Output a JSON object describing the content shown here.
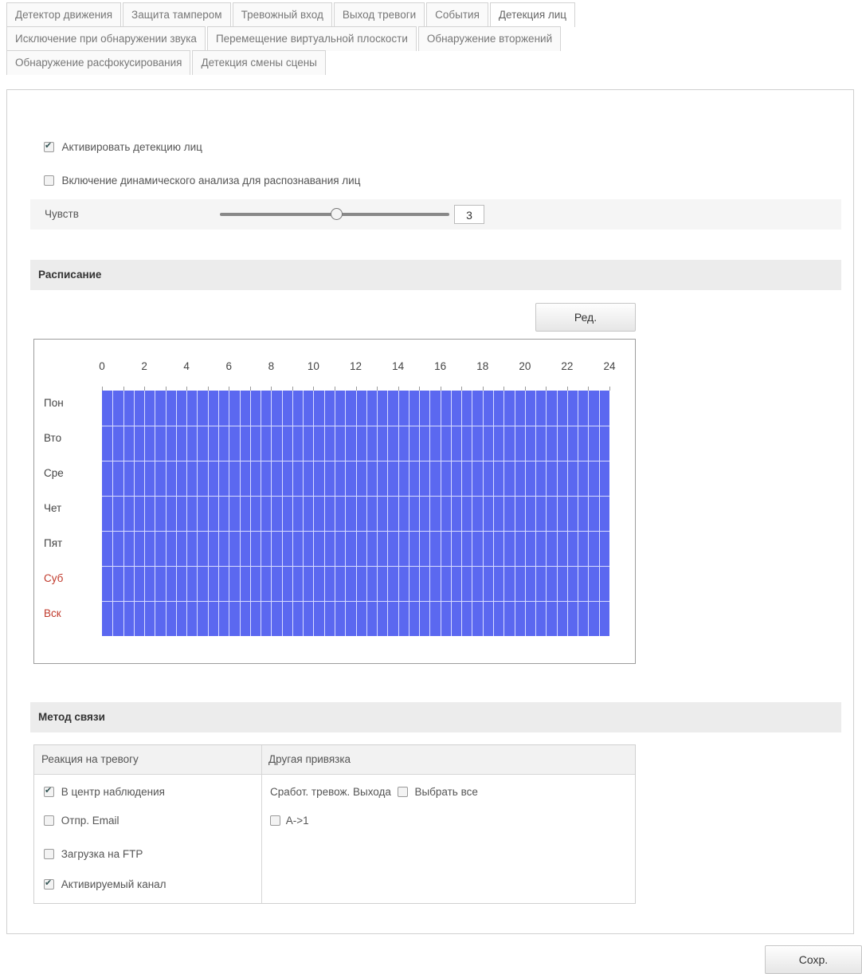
{
  "tabs": {
    "row1": [
      "Детектор движения",
      "Защита тампером",
      "Тревожный вход",
      "Выход тревоги",
      "События",
      "Детекция лиц"
    ],
    "row2": [
      "Исключение при обнаружении звука",
      "Перемещение виртуальной плоскости",
      "Обнаружение вторжений"
    ],
    "row3": [
      "Обнаружение расфокусирования",
      "Детекция смены сцены"
    ],
    "active": "Детекция лиц"
  },
  "settings": {
    "enable_label": "Активировать детекцию лиц",
    "enable_checked": true,
    "dynamic_label": "Включение динамического анализа для распознавания лиц",
    "dynamic_checked": false,
    "sensitivity_label": "Чувств",
    "sensitivity_value": "3",
    "sensitivity_max": 5
  },
  "schedule": {
    "title": "Расписание",
    "edit_button": "Ред.",
    "hours": [
      "0",
      "2",
      "4",
      "6",
      "8",
      "10",
      "12",
      "14",
      "16",
      "18",
      "20",
      "22",
      "24"
    ],
    "days": [
      "Пон",
      "Вто",
      "Сре",
      "Чет",
      "Пят",
      "Суб",
      "Вск"
    ],
    "weekend_days": [
      "Суб",
      "Вск"
    ],
    "fill_color": "#5b68f0"
  },
  "linkage": {
    "title": "Метод связи",
    "col1_header": "Реакция на тревогу",
    "col2_header": "Другая привязка",
    "alarm_actions": [
      {
        "label": "В центр наблюдения",
        "checked": true
      },
      {
        "label": "Отпр. Email",
        "checked": false
      },
      {
        "label": "Загрузка на FTP",
        "checked": false
      },
      {
        "label": "Активируемый канал",
        "checked": true
      }
    ],
    "trigger_output_label": "Сработ. тревож. Выхода",
    "select_all_label": "Выбрать все",
    "outputs": [
      {
        "label": "A->1",
        "checked": false
      }
    ]
  },
  "save_button": "Сохр."
}
